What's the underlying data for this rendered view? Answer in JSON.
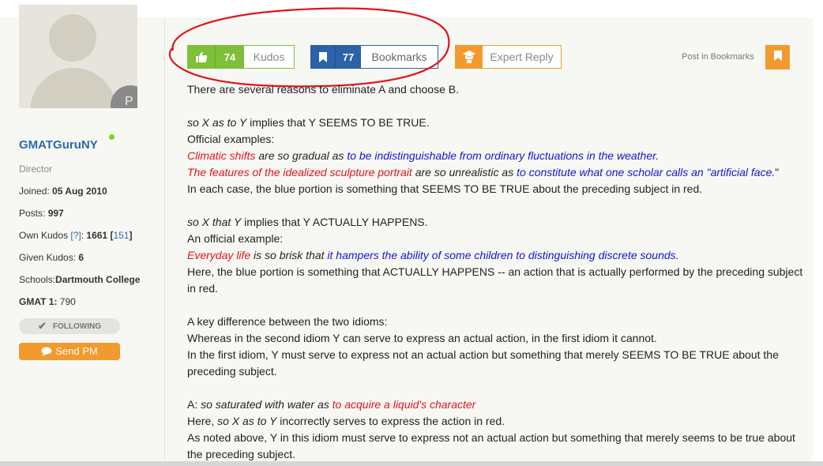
{
  "sidebar": {
    "avatar_badge": "P",
    "username": "GMATGuruNY",
    "rank": "Director",
    "joined_label": "Joined:",
    "joined_value": "05 Aug 2010",
    "posts_label": "Posts:",
    "posts_value": "997",
    "own_kudos_label": "Own Kudos",
    "own_kudos_help": "[?]",
    "own_kudos_value": "1661",
    "own_kudos_extra": "151",
    "given_kudos_label": "Given Kudos:",
    "given_kudos_value": "6",
    "schools_label": "Schools:",
    "schools_value": "Dartmouth College",
    "gmat_label": "GMAT 1:",
    "gmat_value": "790",
    "following_label": "FOLLOWING",
    "sendpm_label": "Send PM"
  },
  "actions": {
    "kudos_count": "74",
    "kudos_label": "Kudos",
    "bookmarks_count": "77",
    "bookmarks_label": "Bookmarks",
    "expert_label": "Expert Reply",
    "post_in_bookmarks": "Post in Bookmarks"
  },
  "post": {
    "l1": "There are several reasons to eliminate A and choose B.",
    "l2a": "so X as to Y",
    "l2b": " implies that Y SEEMS TO BE TRUE.",
    "l3": "Official examples:",
    "l4a": "Climatic shifts",
    "l4b": " are so gradual as ",
    "l4c": "to be indistinguishable from ordinary fluctuations in the weather.",
    "l5a": "The features of the idealized sculpture portrait",
    "l5b": " are so unrealistic as ",
    "l5c": "to constitute what one scholar calls an \"artificial face.",
    "l5d": "\"",
    "l6": "In each case, the blue portion is something that SEEMS TO BE TRUE about the preceding subject in red.",
    "l7a": "so X that Y",
    "l7b": " implies that Y ACTUALLY HAPPENS.",
    "l8": "An official example:",
    "l9a": "Everyday life",
    "l9b": " is so brisk that ",
    "l9c": "it hampers the ability of some children to distinguishing discrete sounds.",
    "l10": "Here, the blue portion is something that ACTUALLY HAPPENS -- an action that is actually performed by the preceding subject in red.",
    "l11": "A key difference between the two idioms:",
    "l12": "Whereas in the second idiom Y can serve to express an actual action, in the first idiom it cannot.",
    "l13": "In the first idiom, Y must serve to express not an actual action but something that merely SEEMS TO BE TRUE about the preceding subject.",
    "l14a": "A: ",
    "l14b": "so saturated with water as ",
    "l14c": "to acquire a liquid's character",
    "l15a": "Here, ",
    "l15b": "so X as to Y",
    "l15c": " incorrectly serves to express the action in red.",
    "l16": "As noted above, Y in this idiom must serve to express not an actual action but something that merely seems to be true about the preceding subject."
  },
  "colors": {
    "kudos": "#7fbf3a",
    "bookmarks": "#2b62a8",
    "orange": "#f29a2e",
    "annotation": "#e0141e",
    "red_text": "#e0141e",
    "blue_text": "#1414d2"
  }
}
